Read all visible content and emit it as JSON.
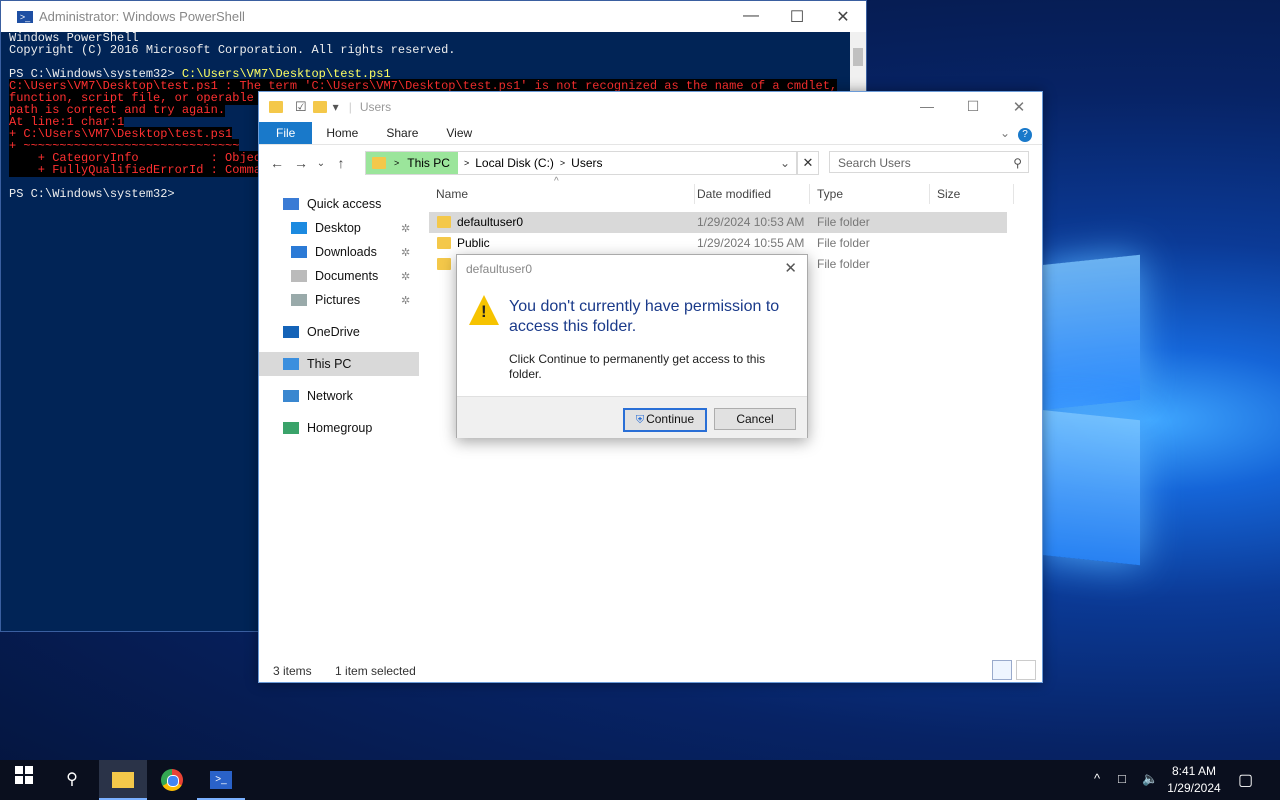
{
  "powershell": {
    "title": "Administrator: Windows PowerShell",
    "lines": [
      {
        "text": "Windows PowerShell",
        "cls": ""
      },
      {
        "text": "Copyright (C) 2016 Microsoft Corporation. All rights reserved.",
        "cls": ""
      },
      {
        "text": "",
        "cls": ""
      },
      {
        "text": "PS C:\\Windows\\system32> C:\\Users\\VM7\\Desktop\\test.ps1",
        "cls": "cmd"
      },
      {
        "text": "C:\\Users\\VM7\\Desktop\\test.ps1 : The term 'C:\\Users\\VM7\\Desktop\\test.ps1' is not recognized as the name of a cmdlet,",
        "cls": "err"
      },
      {
        "text": "function, script file, or operable p",
        "cls": "err"
      },
      {
        "text": "path is correct and try again.",
        "cls": "err"
      },
      {
        "text": "At line:1 char:1",
        "cls": "err"
      },
      {
        "text": "+ C:\\Users\\VM7\\Desktop\\test.ps1",
        "cls": "err"
      },
      {
        "text": "+ ~~~~~~~~~~~~~~~~~~~~~~~~~~~~~~",
        "cls": "err"
      },
      {
        "text": "    + CategoryInfo          : Object",
        "cls": "err"
      },
      {
        "text": "    + FullyQualifiedErrorId : Comman",
        "cls": "err"
      },
      {
        "text": "",
        "cls": ""
      },
      {
        "text": "PS C:\\Windows\\system32>",
        "cls": ""
      }
    ]
  },
  "explorer": {
    "title": "Users",
    "ribbon_tabs": [
      "File",
      "Home",
      "Share",
      "View"
    ],
    "breadcrumb": [
      "This PC",
      "Local Disk (C:)",
      "Users"
    ],
    "search_placeholder": "Search Users",
    "sidebar": [
      {
        "label": "Quick access",
        "icon": "star-icon",
        "pinned": false,
        "indent": false
      },
      {
        "label": "Desktop",
        "icon": "desktop-icon",
        "pinned": true,
        "indent": true
      },
      {
        "label": "Downloads",
        "icon": "download-icon",
        "pinned": true,
        "indent": true
      },
      {
        "label": "Documents",
        "icon": "documents-icon",
        "pinned": true,
        "indent": true
      },
      {
        "label": "Pictures",
        "icon": "pictures-icon",
        "pinned": true,
        "indent": true
      },
      {
        "label": "OneDrive",
        "icon": "cloud-icon",
        "pinned": false,
        "indent": false
      },
      {
        "label": "This PC",
        "icon": "computer-icon",
        "pinned": false,
        "indent": false
      },
      {
        "label": "Network",
        "icon": "network-icon",
        "pinned": false,
        "indent": false
      },
      {
        "label": "Homegroup",
        "icon": "homegroup-icon",
        "pinned": false,
        "indent": false
      }
    ],
    "selected_sidebar": "This PC",
    "columns": {
      "name": "Name",
      "date": "Date modified",
      "type": "Type",
      "size": "Size"
    },
    "files": [
      {
        "name": "defaultuser0",
        "date": "1/29/2024 10:53 AM",
        "type": "File folder",
        "selected": true
      },
      {
        "name": "Public",
        "date": "1/29/2024 10:55 AM",
        "type": "File folder",
        "selected": false
      },
      {
        "name": "",
        "date": "",
        "type": "File folder",
        "selected": false
      }
    ],
    "status_items": "3 items",
    "status_selected": "1 item selected"
  },
  "dialog": {
    "title": "defaultuser0",
    "heading": "You don't currently have permission to access this folder.",
    "body": "Click Continue to permanently get access to this folder.",
    "continue_label": "Continue",
    "cancel_label": "Cancel"
  },
  "taskbar": {
    "time": "8:41 AM",
    "date": "1/29/2024"
  }
}
